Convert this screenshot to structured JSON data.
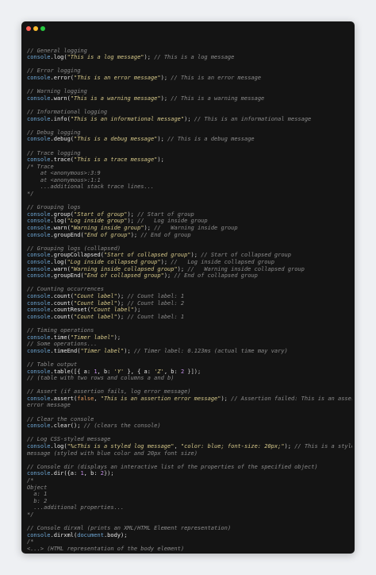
{
  "window": {
    "controls": [
      "close",
      "minimize",
      "maximize"
    ]
  },
  "lines": [
    [],
    [
      {
        "t": "// General logging",
        "c": "comment"
      }
    ],
    [
      {
        "t": "console",
        "c": "obj"
      },
      {
        "t": ".log(",
        "c": "fn"
      },
      {
        "t": "\"This is a log message\"",
        "c": "str"
      },
      {
        "t": "); ",
        "c": "punc"
      },
      {
        "t": "// This is a log message",
        "c": "comment"
      }
    ],
    [],
    [
      {
        "t": "// Error logging",
        "c": "comment"
      }
    ],
    [
      {
        "t": "console",
        "c": "obj"
      },
      {
        "t": ".error(",
        "c": "fn"
      },
      {
        "t": "\"This is an error message\"",
        "c": "str"
      },
      {
        "t": "); ",
        "c": "punc"
      },
      {
        "t": "// This is an error message",
        "c": "comment"
      }
    ],
    [],
    [
      {
        "t": "// Warning logging",
        "c": "comment"
      }
    ],
    [
      {
        "t": "console",
        "c": "obj"
      },
      {
        "t": ".warn(",
        "c": "fn"
      },
      {
        "t": "\"This is a warning message\"",
        "c": "str"
      },
      {
        "t": "); ",
        "c": "punc"
      },
      {
        "t": "// This is a warning message",
        "c": "comment"
      }
    ],
    [],
    [
      {
        "t": "// Informational logging",
        "c": "comment"
      }
    ],
    [
      {
        "t": "console",
        "c": "obj"
      },
      {
        "t": ".info(",
        "c": "fn"
      },
      {
        "t": "\"This is an informational message\"",
        "c": "str"
      },
      {
        "t": "); ",
        "c": "punc"
      },
      {
        "t": "// This is an informational message",
        "c": "comment"
      }
    ],
    [],
    [
      {
        "t": "// Debug logging",
        "c": "comment"
      }
    ],
    [
      {
        "t": "console",
        "c": "obj"
      },
      {
        "t": ".debug(",
        "c": "fn"
      },
      {
        "t": "\"This is a debug message\"",
        "c": "str"
      },
      {
        "t": "); ",
        "c": "punc"
      },
      {
        "t": "// This is a debug message",
        "c": "comment"
      }
    ],
    [],
    [
      {
        "t": "// Trace logging",
        "c": "comment"
      }
    ],
    [
      {
        "t": "console",
        "c": "obj"
      },
      {
        "t": ".trace(",
        "c": "fn"
      },
      {
        "t": "\"This is a trace message\"",
        "c": "str"
      },
      {
        "t": ");",
        "c": "punc"
      }
    ],
    [
      {
        "t": "/* Trace",
        "c": "comment"
      }
    ],
    [
      {
        "t": "    at <anonymous>:3:9",
        "c": "comment"
      }
    ],
    [
      {
        "t": "    at <anonymous>:1:1",
        "c": "comment"
      }
    ],
    [
      {
        "t": "    ...additional stack trace lines...",
        "c": "comment"
      }
    ],
    [
      {
        "t": "*/",
        "c": "comment"
      }
    ],
    [],
    [
      {
        "t": "// Grouping logs",
        "c": "comment"
      }
    ],
    [
      {
        "t": "console",
        "c": "obj"
      },
      {
        "t": ".group(",
        "c": "fn"
      },
      {
        "t": "\"Start of group\"",
        "c": "str"
      },
      {
        "t": "); ",
        "c": "punc"
      },
      {
        "t": "// Start of group",
        "c": "comment"
      }
    ],
    [
      {
        "t": "console",
        "c": "obj"
      },
      {
        "t": ".log(",
        "c": "fn"
      },
      {
        "t": "\"Log inside group\"",
        "c": "str"
      },
      {
        "t": "); ",
        "c": "punc"
      },
      {
        "t": "//   Log inside group",
        "c": "comment"
      }
    ],
    [
      {
        "t": "console",
        "c": "obj"
      },
      {
        "t": ".warn(",
        "c": "fn"
      },
      {
        "t": "\"Warning inside group\"",
        "c": "str"
      },
      {
        "t": "); ",
        "c": "punc"
      },
      {
        "t": "//   Warning inside group",
        "c": "comment"
      }
    ],
    [
      {
        "t": "console",
        "c": "obj"
      },
      {
        "t": ".groupEnd(",
        "c": "fn"
      },
      {
        "t": "\"End of group\"",
        "c": "str"
      },
      {
        "t": "); ",
        "c": "punc"
      },
      {
        "t": "// End of group",
        "c": "comment"
      }
    ],
    [],
    [
      {
        "t": "// Grouping logs (collapsed)",
        "c": "comment"
      }
    ],
    [
      {
        "t": "console",
        "c": "obj"
      },
      {
        "t": ".groupCollapsed(",
        "c": "fn"
      },
      {
        "t": "\"Start of collapsed group\"",
        "c": "str"
      },
      {
        "t": "); ",
        "c": "punc"
      },
      {
        "t": "// Start of collapsed group",
        "c": "comment"
      }
    ],
    [
      {
        "t": "console",
        "c": "obj"
      },
      {
        "t": ".log(",
        "c": "fn"
      },
      {
        "t": "\"Log inside collapsed group\"",
        "c": "str"
      },
      {
        "t": "); ",
        "c": "punc"
      },
      {
        "t": "//   Log inside collapsed group",
        "c": "comment"
      }
    ],
    [
      {
        "t": "console",
        "c": "obj"
      },
      {
        "t": ".warn(",
        "c": "fn"
      },
      {
        "t": "\"Warning inside collapsed group\"",
        "c": "str"
      },
      {
        "t": "); ",
        "c": "punc"
      },
      {
        "t": "//   Warning inside collapsed group",
        "c": "comment"
      }
    ],
    [
      {
        "t": "console",
        "c": "obj"
      },
      {
        "t": ".groupEnd(",
        "c": "fn"
      },
      {
        "t": "\"End of collapsed group\"",
        "c": "str"
      },
      {
        "t": "); ",
        "c": "punc"
      },
      {
        "t": "// End of collapsed group",
        "c": "comment"
      }
    ],
    [],
    [
      {
        "t": "// Counting occurrences",
        "c": "comment"
      }
    ],
    [
      {
        "t": "console",
        "c": "obj"
      },
      {
        "t": ".count(",
        "c": "fn"
      },
      {
        "t": "\"Count label\"",
        "c": "str"
      },
      {
        "t": "); ",
        "c": "punc"
      },
      {
        "t": "// Count label: 1",
        "c": "comment"
      }
    ],
    [
      {
        "t": "console",
        "c": "obj"
      },
      {
        "t": ".count(",
        "c": "fn"
      },
      {
        "t": "\"Count label\"",
        "c": "str"
      },
      {
        "t": "); ",
        "c": "punc"
      },
      {
        "t": "// Count label: 2",
        "c": "comment"
      }
    ],
    [
      {
        "t": "console",
        "c": "obj"
      },
      {
        "t": ".countReset(",
        "c": "fn"
      },
      {
        "t": "\"Count label\"",
        "c": "str"
      },
      {
        "t": ");",
        "c": "punc"
      }
    ],
    [
      {
        "t": "console",
        "c": "obj"
      },
      {
        "t": ".count(",
        "c": "fn"
      },
      {
        "t": "\"Count label\"",
        "c": "str"
      },
      {
        "t": "); ",
        "c": "punc"
      },
      {
        "t": "// Count label: 1",
        "c": "comment"
      }
    ],
    [],
    [
      {
        "t": "// Timing operations",
        "c": "comment"
      }
    ],
    [
      {
        "t": "console",
        "c": "obj"
      },
      {
        "t": ".time(",
        "c": "fn"
      },
      {
        "t": "\"Timer label\"",
        "c": "str"
      },
      {
        "t": ");",
        "c": "punc"
      }
    ],
    [
      {
        "t": "// Some operations...",
        "c": "comment"
      }
    ],
    [
      {
        "t": "console",
        "c": "obj"
      },
      {
        "t": ".timeEnd(",
        "c": "fn"
      },
      {
        "t": "\"Timer label\"",
        "c": "str"
      },
      {
        "t": "); ",
        "c": "punc"
      },
      {
        "t": "// Timer label: 0.123ms (actual time may vary)",
        "c": "comment"
      }
    ],
    [],
    [
      {
        "t": "// Table output",
        "c": "comment"
      }
    ],
    [
      {
        "t": "console",
        "c": "obj"
      },
      {
        "t": ".table([{ a: ",
        "c": "fn"
      },
      {
        "t": "1",
        "c": "num"
      },
      {
        "t": ", b: ",
        "c": "fn"
      },
      {
        "t": "'Y'",
        "c": "str"
      },
      {
        "t": " }, { a: ",
        "c": "fn"
      },
      {
        "t": "'Z'",
        "c": "str"
      },
      {
        "t": ", b: ",
        "c": "fn"
      },
      {
        "t": "2",
        "c": "num"
      },
      {
        "t": " }]);",
        "c": "punc"
      }
    ],
    [
      {
        "t": "// (table with two rows and columns a and b)",
        "c": "comment"
      }
    ],
    [],
    [
      {
        "t": "// Assert (if assertion fails, log error message)",
        "c": "comment"
      }
    ],
    [
      {
        "t": "console",
        "c": "obj"
      },
      {
        "t": ".assert(",
        "c": "fn"
      },
      {
        "t": "false",
        "c": "kw"
      },
      {
        "t": ", ",
        "c": "punc"
      },
      {
        "t": "\"This is an assertion error message\"",
        "c": "str"
      },
      {
        "t": "); ",
        "c": "punc"
      },
      {
        "t": "// Assertion failed: This is an assertion",
        "c": "comment"
      }
    ],
    [
      {
        "t": "error message",
        "c": "comment"
      }
    ],
    [],
    [
      {
        "t": "// Clear the console",
        "c": "comment"
      }
    ],
    [
      {
        "t": "console",
        "c": "obj"
      },
      {
        "t": ".clear(); ",
        "c": "fn"
      },
      {
        "t": "// (clears the console)",
        "c": "comment"
      }
    ],
    [],
    [
      {
        "t": "// Log CSS-styled message",
        "c": "comment"
      }
    ],
    [
      {
        "t": "console",
        "c": "obj"
      },
      {
        "t": ".log(",
        "c": "fn"
      },
      {
        "t": "\"%cThis is a styled log message\"",
        "c": "str"
      },
      {
        "t": ", ",
        "c": "punc"
      },
      {
        "t": "\"color: blue; font-size: 20px;\"",
        "c": "str"
      },
      {
        "t": "); ",
        "c": "punc"
      },
      {
        "t": "// This is a styled log",
        "c": "comment"
      }
    ],
    [
      {
        "t": "message (styled with blue color and 20px font size)",
        "c": "comment"
      }
    ],
    [],
    [
      {
        "t": "// Console dir (displays an interactive list of the properties of the specified object)",
        "c": "comment"
      }
    ],
    [
      {
        "t": "console",
        "c": "obj"
      },
      {
        "t": ".dir({a: ",
        "c": "fn"
      },
      {
        "t": "1",
        "c": "num"
      },
      {
        "t": ", b: ",
        "c": "fn"
      },
      {
        "t": "2",
        "c": "num"
      },
      {
        "t": "});",
        "c": "punc"
      }
    ],
    [
      {
        "t": "/*",
        "c": "comment"
      }
    ],
    [
      {
        "t": "Object",
        "c": "comment"
      }
    ],
    [
      {
        "t": "  a: 1",
        "c": "comment"
      }
    ],
    [
      {
        "t": "  b: 2",
        "c": "comment"
      }
    ],
    [
      {
        "t": "  ...additional properties...",
        "c": "comment"
      }
    ],
    [
      {
        "t": "*/",
        "c": "comment"
      }
    ],
    [],
    [
      {
        "t": "// Console dirxml (prints an XML/HTML Element representation)",
        "c": "comment"
      }
    ],
    [
      {
        "t": "console",
        "c": "obj"
      },
      {
        "t": ".dirxml(",
        "c": "fn"
      },
      {
        "t": "document",
        "c": "obj"
      },
      {
        "t": ".body);",
        "c": "fn"
      }
    ],
    [
      {
        "t": "/*",
        "c": "comment"
      }
    ],
    [
      {
        "t": "<...> (HTML representation of the body element)",
        "c": "comment"
      }
    ],
    [
      {
        "t": "*/",
        "c": "comment"
      }
    ]
  ]
}
